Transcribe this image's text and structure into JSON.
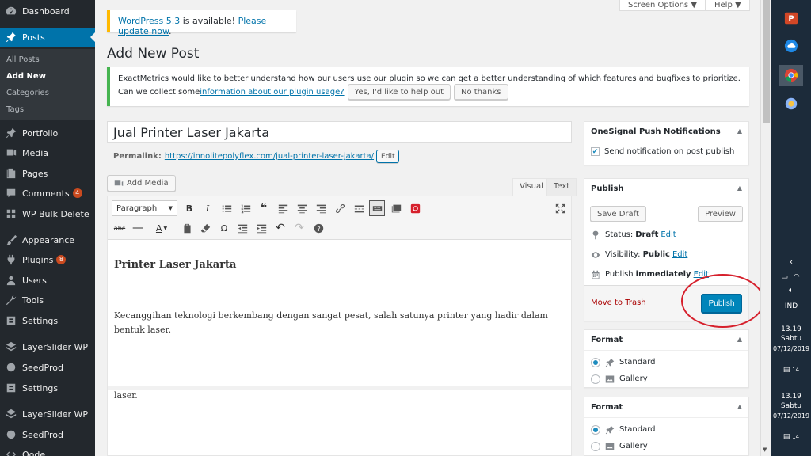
{
  "sidebar": {
    "items": [
      {
        "label": "Dashboard",
        "icon": "dashboard-icon"
      },
      {
        "label": "Posts",
        "icon": "pin-icon",
        "active": true
      },
      {
        "label": "Portfolio",
        "icon": "pin-icon"
      },
      {
        "label": "Media",
        "icon": "media-icon"
      },
      {
        "label": "Pages",
        "icon": "pages-icon"
      },
      {
        "label": "Comments",
        "icon": "comments-icon",
        "badge": "4"
      },
      {
        "label": "WP Bulk Delete",
        "icon": "grid-icon"
      },
      {
        "label": "Appearance",
        "icon": "brush-icon"
      },
      {
        "label": "Plugins",
        "icon": "plugin-icon",
        "badge": "8"
      },
      {
        "label": "Users",
        "icon": "users-icon"
      },
      {
        "label": "Tools",
        "icon": "tools-icon"
      },
      {
        "label": "Settings",
        "icon": "settings-icon"
      },
      {
        "label": "LayerSlider WP",
        "icon": "layers-icon"
      },
      {
        "label": "SeedProd",
        "icon": "seed-icon"
      },
      {
        "label": "Settings",
        "icon": "settings-icon"
      },
      {
        "label": "LayerSlider WP",
        "icon": "layers-icon"
      },
      {
        "label": "SeedProd",
        "icon": "seed-icon"
      },
      {
        "label": "Oode",
        "icon": "code-icon"
      }
    ],
    "submenu": [
      "All Posts",
      "Add New",
      "Categories",
      "Tags"
    ]
  },
  "header": {
    "screen_options": "Screen Options ▼",
    "help": "Help ▼"
  },
  "update_notice": {
    "version_link": "WordPress 5.3",
    "text": " is available! ",
    "update_link": "Please update now",
    "end": "."
  },
  "page_title": "Add New Post",
  "exactmetrics": {
    "line1": "ExactMetrics would like to better understand how our users use our plugin so we can get a better understanding of which features and bugfixes to prioritize.",
    "line2_pre": "Can we collect some ",
    "line2_link": "information about our plugin usage?",
    "accept": "Yes, I'd like to help out",
    "decline": "No thanks"
  },
  "post": {
    "title": "Jual Printer Laser Jakarta",
    "permalink_label": "Permalink:",
    "permalink_url": "https://innolitepolyflex.com/jual-printer-laser-jakarta/",
    "permalink_edit": "Edit"
  },
  "editor": {
    "add_media": "Add Media",
    "tab_visual": "Visual",
    "tab_text": "Text",
    "format": "Paragraph",
    "heading": "Printer Laser Jakarta",
    "paragraph": "Kecanggihan teknologi berkembang dengan sangat pesat, salah satunya printer yang hadir dalam bentuk laser.",
    "paragraph2": "laser."
  },
  "onesignal": {
    "title": "OneSignal Push Notifications",
    "checkbox": "Send notification on post publish"
  },
  "publish": {
    "title": "Publish",
    "save_draft": "Save Draft",
    "preview": "Preview",
    "status_label": "Status:",
    "status_value": "Draft",
    "visibility_label": "Visibility:",
    "visibility_value": "Public",
    "publish_label": "Publish",
    "publish_value": "immediately",
    "edit": "Edit",
    "trash": "Move to Trash",
    "publish_button": "Publish"
  },
  "format_box": {
    "title": "Format",
    "options": [
      "Standard",
      "Gallery"
    ]
  },
  "taskbar": {
    "lang": "IND",
    "time": "13.19",
    "day": "Sabtu",
    "date": "07/12/2019",
    "notif": "14"
  },
  "colors": {
    "sidebar_bg": "#23282d",
    "accent": "#0073aa",
    "primary_button": "#0085ba",
    "highlight": "#d6202c"
  }
}
